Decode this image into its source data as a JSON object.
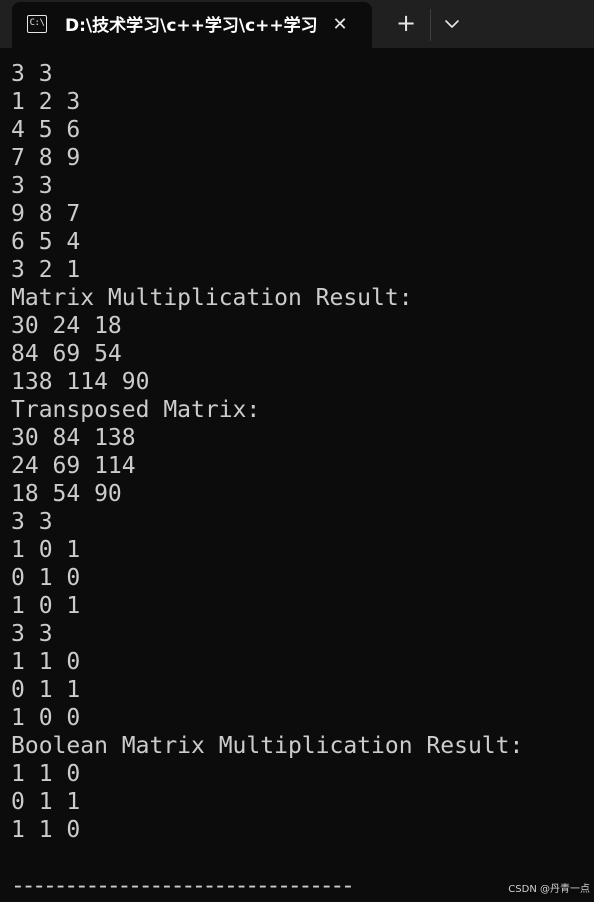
{
  "window": {
    "tab_title": "D:\\技术学习\\c++学习\\c++学习",
    "tab_icon_text": "C:\\",
    "close_symbol": "✕",
    "new_tab_symbol": "+",
    "icons": {
      "tab_icon": "terminal-icon",
      "close": "close-icon",
      "new_tab": "plus-icon",
      "dropdown": "chevron-down-icon"
    }
  },
  "terminal": {
    "lines": [
      "3 3",
      "1 2 3",
      "4 5 6",
      "7 8 9",
      "3 3",
      "9 8 7",
      "6 5 4",
      "3 2 1",
      "Matrix Multiplication Result:",
      "30 24 18",
      "84 69 54",
      "138 114 90",
      "Transposed Matrix:",
      "30 84 138",
      "24 69 114",
      "18 54 90",
      "3 3",
      "1 0 1",
      "0 1 0",
      "1 0 1",
      "3 3",
      "1 1 0",
      "0 1 1",
      "1 0 0",
      "Boolean Matrix Multiplication Result:",
      "1 1 0",
      "0 1 1",
      "1 1 0"
    ],
    "separator": "--------------------------------"
  },
  "watermark": "CSDN @丹青一点",
  "colors": {
    "background": "#0c0c0c",
    "titlebar": "#202020",
    "text": "#cccccc"
  }
}
